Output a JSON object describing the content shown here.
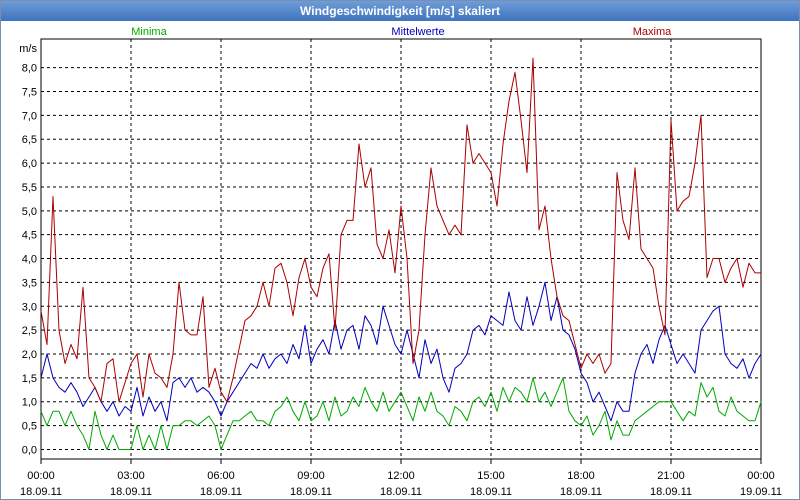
{
  "window": {
    "title": "Windgeschwindigkeit [m/s] skaliert"
  },
  "chart_data": {
    "type": "line",
    "title": "Windgeschwindigkeit [m/s] skaliert",
    "ylabel": "m/s",
    "xlabel": "",
    "ylim": [
      -0.2,
      8.6
    ],
    "xlim": [
      "18.09.11 00:00",
      "19.09.11 00:00"
    ],
    "grid": true,
    "legend_position": "top",
    "yticks": [
      "0,0",
      "0,5",
      "1,0",
      "1,5",
      "2,0",
      "2,5",
      "3,0",
      "3,5",
      "4,0",
      "4,5",
      "5,0",
      "5,5",
      "6,0",
      "6,5",
      "7,0",
      "7,5",
      "8,0"
    ],
    "xticks": [
      {
        "time": "00:00",
        "date": "18.09.11"
      },
      {
        "time": "03:00",
        "date": "18.09.11"
      },
      {
        "time": "06:00",
        "date": "18.09.11"
      },
      {
        "time": "09:00",
        "date": "18.09.11"
      },
      {
        "time": "12:00",
        "date": "18.09.11"
      },
      {
        "time": "15:00",
        "date": "18.09.11"
      },
      {
        "time": "18:00",
        "date": "18.09.11"
      },
      {
        "time": "21:00",
        "date": "18.09.11"
      },
      {
        "time": "00:00",
        "date": "19.09.11"
      }
    ],
    "x_hours": [
      0,
      0.2,
      0.4,
      0.6,
      0.8,
      1,
      1.2,
      1.4,
      1.6,
      1.8,
      2,
      2.2,
      2.4,
      2.6,
      2.8,
      3,
      3.2,
      3.4,
      3.6,
      3.8,
      4,
      4.2,
      4.4,
      4.6,
      4.8,
      5,
      5.2,
      5.4,
      5.6,
      5.8,
      6,
      6.2,
      6.4,
      6.6,
      6.8,
      7,
      7.2,
      7.4,
      7.6,
      7.8,
      8,
      8.2,
      8.4,
      8.6,
      8.8,
      9,
      9.2,
      9.4,
      9.6,
      9.8,
      10,
      10.2,
      10.4,
      10.6,
      10.8,
      11,
      11.2,
      11.4,
      11.6,
      11.8,
      12,
      12.2,
      12.4,
      12.6,
      12.8,
      13,
      13.2,
      13.4,
      13.6,
      13.8,
      14,
      14.2,
      14.4,
      14.6,
      14.8,
      15,
      15.2,
      15.4,
      15.6,
      15.8,
      16,
      16.2,
      16.4,
      16.6,
      16.8,
      17,
      17.2,
      17.4,
      17.6,
      17.8,
      18,
      18.2,
      18.4,
      18.6,
      18.8,
      19,
      19.2,
      19.4,
      19.6,
      19.8,
      20,
      20.2,
      20.4,
      20.6,
      20.8,
      21,
      21.2,
      21.4,
      21.6,
      21.8,
      22,
      22.2,
      22.4,
      22.6,
      22.8,
      23,
      23.2,
      23.4,
      23.6,
      23.8,
      24
    ],
    "series": [
      {
        "name": "Minima",
        "color": "#00aa00",
        "values": [
          0.8,
          0.5,
          0.8,
          0.8,
          0.5,
          0.8,
          0.5,
          0.3,
          0.0,
          0.8,
          0.3,
          0.0,
          0.3,
          0.0,
          0.0,
          0.0,
          0.5,
          0.0,
          0.3,
          0.0,
          0.5,
          0.0,
          0.5,
          0.5,
          0.6,
          0.6,
          0.5,
          0.6,
          0.7,
          0.5,
          0.0,
          0.3,
          0.6,
          0.6,
          0.7,
          0.8,
          0.6,
          0.6,
          0.5,
          0.8,
          0.9,
          1.1,
          0.8,
          0.6,
          1.0,
          0.6,
          0.7,
          1.0,
          0.6,
          1.1,
          0.7,
          0.8,
          1.1,
          0.9,
          1.3,
          1.0,
          0.8,
          1.2,
          0.8,
          1.0,
          1.2,
          0.9,
          0.6,
          1.1,
          0.8,
          1.2,
          0.8,
          0.7,
          0.5,
          0.9,
          0.8,
          0.6,
          1.0,
          1.1,
          0.9,
          1.2,
          0.8,
          1.3,
          1.0,
          1.3,
          1.2,
          1.0,
          1.5,
          1.0,
          1.2,
          0.9,
          1.2,
          1.5,
          0.8,
          0.6,
          0.5,
          0.7,
          0.3,
          0.5,
          0.8,
          0.2,
          0.6,
          0.3,
          0.3,
          0.6,
          0.7,
          0.8,
          0.9,
          1.0,
          1.0,
          1.0,
          0.8,
          0.6,
          0.8,
          0.7,
          1.4,
          1.1,
          1.3,
          0.8,
          0.7,
          1.1,
          0.8,
          0.7,
          0.6,
          0.6,
          1.0
        ]
      },
      {
        "name": "Mittelwerte",
        "color": "#0000bb",
        "values": [
          1.5,
          2.0,
          1.5,
          1.3,
          1.2,
          1.4,
          1.2,
          0.9,
          1.1,
          1.3,
          1.0,
          0.8,
          1.0,
          0.7,
          0.9,
          0.8,
          1.3,
          0.7,
          1.1,
          0.8,
          1.0,
          0.6,
          1.4,
          1.5,
          1.3,
          1.5,
          1.2,
          1.3,
          1.2,
          1.0,
          0.7,
          1.0,
          1.2,
          1.4,
          1.6,
          1.8,
          1.7,
          2.0,
          1.7,
          1.9,
          2.0,
          1.8,
          2.2,
          1.9,
          2.6,
          1.8,
          2.1,
          2.3,
          2.0,
          2.7,
          2.1,
          2.5,
          2.6,
          2.1,
          2.8,
          2.6,
          2.2,
          3.0,
          2.6,
          2.2,
          2.0,
          2.5,
          2.0,
          1.5,
          2.3,
          1.8,
          2.1,
          1.5,
          1.2,
          1.7,
          1.8,
          2.0,
          2.5,
          2.6,
          2.4,
          2.8,
          2.7,
          2.6,
          3.3,
          2.7,
          2.5,
          3.2,
          2.6,
          3.0,
          3.5,
          2.7,
          3.2,
          2.5,
          2.4,
          2.1,
          1.6,
          1.4,
          1.0,
          1.2,
          0.9,
          0.6,
          1.0,
          0.8,
          0.8,
          1.6,
          2.0,
          2.2,
          1.8,
          2.3,
          2.6,
          2.2,
          1.8,
          2.0,
          1.8,
          1.6,
          2.5,
          2.7,
          2.9,
          3.0,
          2.0,
          1.8,
          1.7,
          1.9,
          1.5,
          1.8,
          2.0
        ]
      },
      {
        "name": "Maxima",
        "color": "#aa0000",
        "values": [
          2.9,
          2.2,
          5.3,
          2.5,
          1.8,
          2.2,
          1.9,
          3.4,
          1.5,
          1.3,
          1.0,
          1.8,
          1.9,
          1.0,
          1.4,
          1.8,
          2.0,
          1.1,
          2.0,
          1.6,
          1.5,
          1.3,
          2.0,
          3.5,
          2.5,
          2.4,
          2.4,
          3.2,
          1.3,
          1.7,
          1.2,
          1.0,
          1.5,
          2.1,
          2.7,
          2.8,
          3.0,
          3.5,
          3.0,
          3.8,
          3.9,
          3.5,
          2.8,
          3.6,
          4.0,
          3.4,
          3.2,
          3.8,
          4.1,
          2.5,
          4.5,
          4.8,
          4.8,
          6.4,
          5.5,
          5.9,
          4.3,
          4.0,
          4.6,
          3.7,
          5.1,
          4.0,
          1.8,
          2.5,
          4.5,
          5.9,
          5.1,
          4.8,
          4.5,
          4.7,
          4.5,
          6.8,
          6.0,
          6.2,
          6.0,
          5.8,
          5.1,
          6.4,
          7.3,
          7.9,
          6.9,
          5.8,
          8.2,
          4.6,
          5.1,
          4.0,
          3.2,
          2.8,
          2.7,
          2.2,
          1.7,
          2.0,
          1.8,
          2.0,
          1.6,
          1.8,
          5.8,
          4.8,
          4.4,
          5.9,
          4.2,
          4.0,
          3.8,
          3.0,
          2.4,
          6.9,
          5.0,
          5.2,
          5.3,
          6.0,
          7.0,
          3.6,
          4.0,
          4.0,
          3.5,
          3.8,
          4.0,
          3.4,
          3.9,
          3.7,
          3.7
        ]
      }
    ]
  }
}
